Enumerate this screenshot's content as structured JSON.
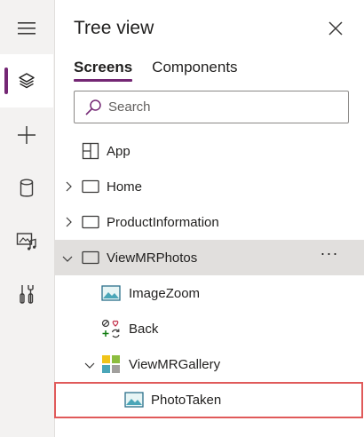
{
  "rail": {
    "items": [
      {
        "icon": "hamburger-menu-icon"
      },
      {
        "icon": "layers-icon",
        "active": true
      },
      {
        "icon": "plus-icon"
      },
      {
        "icon": "database-icon"
      },
      {
        "icon": "media-icon"
      },
      {
        "icon": "tools-icon"
      }
    ]
  },
  "panel": {
    "title": "Tree view",
    "tabs": [
      {
        "label": "Screens",
        "active": true
      },
      {
        "label": "Components",
        "active": false
      }
    ],
    "search": {
      "placeholder": "Search",
      "value": ""
    }
  },
  "tree": {
    "rows": [
      {
        "label": "App",
        "icon": "app-icon"
      },
      {
        "label": "Home",
        "icon": "screen-icon",
        "chevron": "right"
      },
      {
        "label": "ProductInformation",
        "icon": "screen-icon",
        "chevron": "right"
      },
      {
        "label": "ViewMRPhotos",
        "icon": "screen-icon",
        "chevron": "down",
        "selected": true,
        "more": "···"
      },
      {
        "label": "ImageZoom",
        "icon": "image-icon"
      },
      {
        "label": "Back",
        "icon": "back-control-icon"
      },
      {
        "label": "ViewMRGallery",
        "icon": "gallery-icon",
        "chevron": "down"
      },
      {
        "label": "PhotoTaken",
        "icon": "image-icon",
        "highlighted": true
      }
    ]
  },
  "colors": {
    "accent": "#742774",
    "highlight": "#e05a5a",
    "selected_row": "#e1dfdd"
  }
}
